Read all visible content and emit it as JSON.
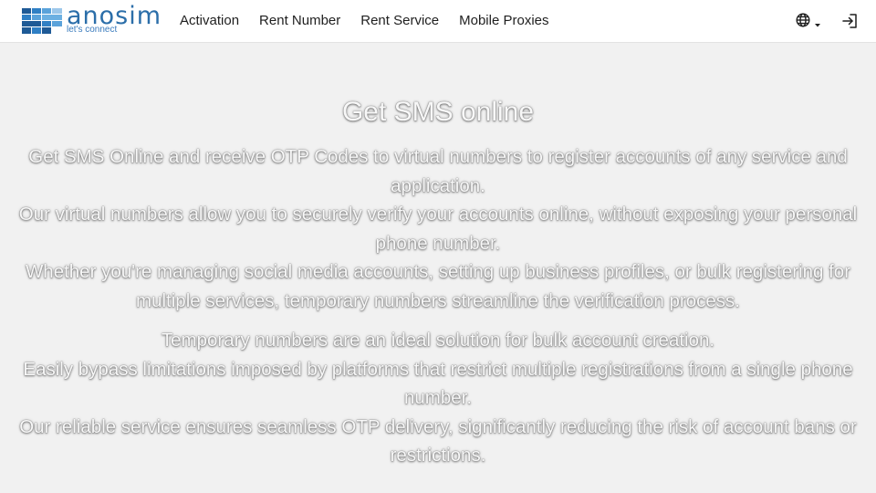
{
  "brand": {
    "name": "anosim",
    "tagline": "let's connect",
    "logo_colors": [
      "#1e5a96",
      "#2f7fc4",
      "#5aa2da",
      "#9cc7ea"
    ]
  },
  "nav": {
    "items": [
      {
        "label": "Activation"
      },
      {
        "label": "Rent Number"
      },
      {
        "label": "Rent Service"
      },
      {
        "label": "Mobile Proxies"
      }
    ]
  },
  "header_icons": {
    "language": "globe-icon",
    "language_caret": "caret-down-icon",
    "login": "sign-in-icon"
  },
  "hero": {
    "title": "Get SMS online",
    "paragraph_1": [
      "Get SMS Online and receive OTP Codes to virtual numbers to register accounts of any service and application.",
      "Our virtual numbers allow you to securely verify your accounts online, without exposing your personal phone number.",
      "Whether you're managing social media accounts, setting up business profiles, or bulk registering for multiple services, temporary numbers streamline the verification process."
    ],
    "paragraph_2": [
      "Temporary numbers are an ideal solution for bulk account creation.",
      "Easily bypass limitations imposed by platforms that restrict multiple registrations from a single phone number.",
      "Our reliable service ensures seamless OTP delivery, significantly reducing the risk of account bans or restrictions."
    ]
  }
}
